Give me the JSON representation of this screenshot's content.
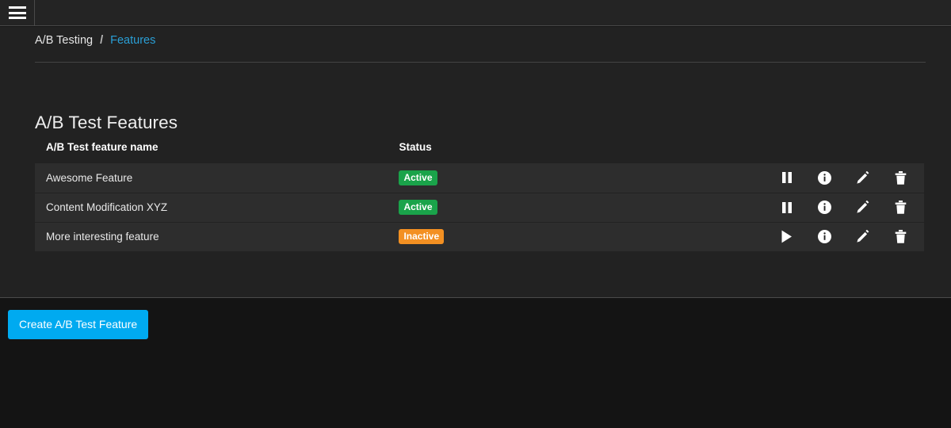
{
  "topbar": {
    "menu_toggle_label": "Toggle navigation",
    "menu_icon": "hamburger-icon"
  },
  "breadcrumb": {
    "parent": "A/B Testing",
    "separator": "/",
    "current": "Features"
  },
  "page": {
    "title": "A/B Test Features"
  },
  "table": {
    "columns": [
      "A/B Test feature name",
      "Status"
    ],
    "rows": [
      {
        "name": "Awesome Feature",
        "status": "Active",
        "status_kind": "active",
        "toggle_icon": "pause-icon",
        "actions": [
          "pause-icon",
          "info-icon",
          "edit-icon",
          "delete-icon"
        ]
      },
      {
        "name": "Content Modification XYZ",
        "status": "Active",
        "status_kind": "active",
        "toggle_icon": "pause-icon",
        "actions": [
          "pause-icon",
          "info-icon",
          "edit-icon",
          "delete-icon"
        ]
      },
      {
        "name": "More interesting feature",
        "status": "Inactive",
        "status_kind": "inactive",
        "toggle_icon": "play-icon",
        "actions": [
          "play-icon",
          "info-icon",
          "edit-icon",
          "delete-icon"
        ]
      }
    ]
  },
  "footer": {
    "create_button": "Create A/B Test Feature"
  },
  "colors": {
    "accent_link": "#2a9fd6",
    "primary_button": "#00aaf0",
    "status_active": "#1aa34a",
    "status_inactive": "#f39022",
    "panel_bg": "#222222",
    "row_bg": "#2d2d2d",
    "page_bg": "#141414"
  }
}
